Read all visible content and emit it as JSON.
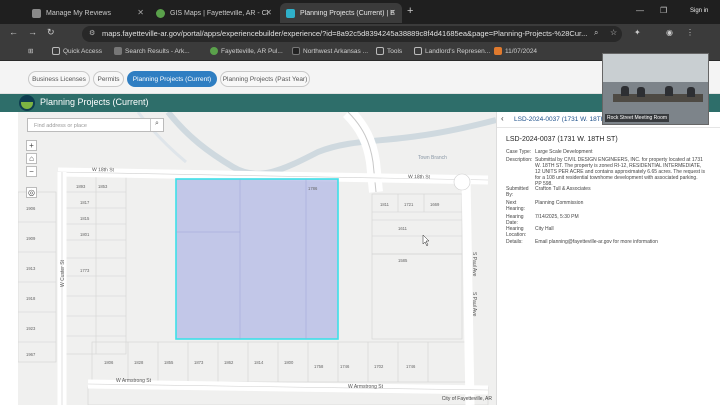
{
  "browser": {
    "tabs": [
      {
        "title": "Manage My Reviews",
        "color": "#8a8a8a"
      },
      {
        "title": "GIS Maps | Fayetteville, AR - CI",
        "color": "#5aa14b"
      },
      {
        "title": "Planning Projects (Current) | E",
        "color": "#2fb0c9"
      }
    ],
    "url": "maps.fayetteville-ar.gov/portal/apps/experiencebuilder/experience/?id=8a92c5d8394245a38889c8f4d41685ea&page=Planning-Projects-%28Cur...",
    "bookmarks": [
      "Quick Access",
      "Search Results - Ark...",
      "Fayetteville, AR Pul...",
      "Northwest Arkansas ...",
      "Tools",
      "Landlord's Represen...",
      "11/07/2024"
    ],
    "sign_in": "Sign in"
  },
  "app": {
    "nav_tabs": [
      "Business Licenses",
      "Permits",
      "Planning Projects (Current)",
      "Planning Projects (Past Year)"
    ],
    "header_title": "Planning Projects (Current)"
  },
  "map": {
    "search_placeholder": "Find address or place",
    "zoom_in": "+",
    "zoom_out": "−",
    "credit": "City of Fayetteville, AR",
    "streets": {
      "w18th_a": "W 18th St",
      "w18th_b": "W 18th St",
      "armstrong_a": "W Armstrong St",
      "armstrong_b": "W Armstrong St",
      "custer": "W Custer St",
      "paul_a": "S Paul Ave",
      "paul_b": "S Paul Ave",
      "creek": "Town Branch"
    },
    "parcels_top": [
      "1893",
      "1853",
      "1817",
      "1815",
      "1801",
      "1786",
      "1773"
    ],
    "parcels_right": [
      "1811",
      "1721",
      "1669",
      "1611",
      "1585"
    ],
    "parcels_bottom": [
      "1806",
      "1828",
      "1855",
      "1873",
      "1862",
      "1814",
      "1800",
      "1758",
      "1746",
      "1702",
      "1746"
    ],
    "parcels_left": [
      "1906",
      "1909",
      "1913",
      "1918",
      "1923",
      "1967"
    ]
  },
  "panel": {
    "header": "LSD-2024-0037 (1731 W. 18TH",
    "record_title": "LSD-2024-0037 (1731 W. 18TH ST)",
    "fields": [
      {
        "k": "Case Type:",
        "v": "Large Scale Development"
      },
      {
        "k": "Description:",
        "v": "Submittal by CIVIL DESIGN ENGINEERS, INC. for property located at 1731 W. 18TH ST. The property is zoned RI-12, RESIDENTIAL INTERMEDIATE, 12 UNITS PER ACRE and contains approximately 6.65 acres. The request is for a 108 unit residential townhome development with associated parking. PP 598."
      },
      {
        "k": "Submitted By:",
        "v": "Crafton Tull & Associates"
      },
      {
        "k": "Next Hearing:",
        "v": "Planning Commission"
      },
      {
        "k": "Hearing Date:",
        "v": "7/14/2025, 5:30 PM"
      },
      {
        "k": "Hearing Location:",
        "v": "City Hall"
      },
      {
        "k": "Details:",
        "v": "Email planning@fayetteville-ar.gov for more information"
      }
    ]
  },
  "camera": {
    "caption": "Rock Street Meeting Room"
  }
}
